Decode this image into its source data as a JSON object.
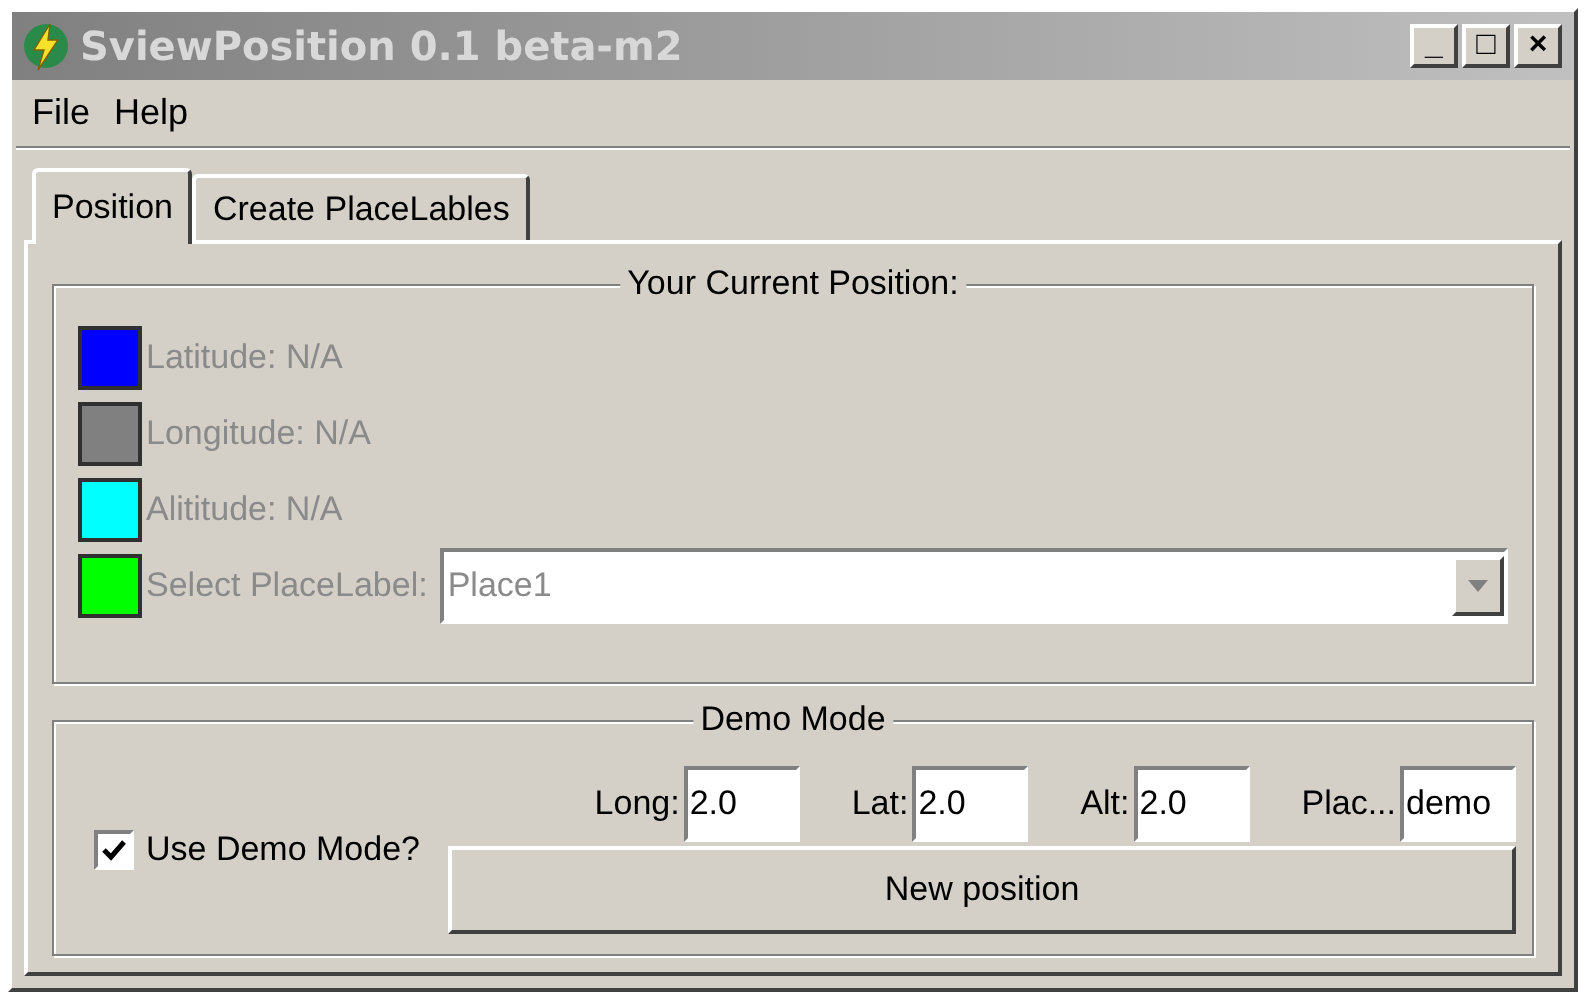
{
  "window": {
    "title": "SviewPosition 0.1 beta-m2",
    "controls": [
      "_",
      "□",
      "×"
    ]
  },
  "menu": [
    "File",
    "Help"
  ],
  "tabs": [
    {
      "label": "Position",
      "selected": true
    },
    {
      "label": "Create PlaceLables",
      "selected": false
    }
  ],
  "position_group": {
    "title": "Your Current Position:",
    "rows": [
      {
        "kind": "text",
        "label": "Latitude: N/A",
        "color": "#0000ff",
        "disabled": true
      },
      {
        "kind": "text",
        "label": "Longitude: N/A",
        "color": "#808080",
        "disabled": true
      },
      {
        "kind": "text",
        "label": "Alititude: N/A",
        "color": "#00ffff",
        "disabled": true
      },
      {
        "kind": "select",
        "label": "Select PlaceLabel:",
        "color": "#00ff00",
        "disabled": true,
        "value": "Place1"
      }
    ]
  },
  "demo_group": {
    "title": "Demo Mode",
    "checkbox": {
      "label": "Use Demo Mode?",
      "checked": true
    },
    "fields": [
      {
        "label": "Long:",
        "value": "2.0"
      },
      {
        "label": "Lat:",
        "value": "2.0"
      },
      {
        "label": "Alt:",
        "value": "2.0"
      },
      {
        "label": "Plac...",
        "value": "demo"
      }
    ],
    "button": "New position"
  }
}
